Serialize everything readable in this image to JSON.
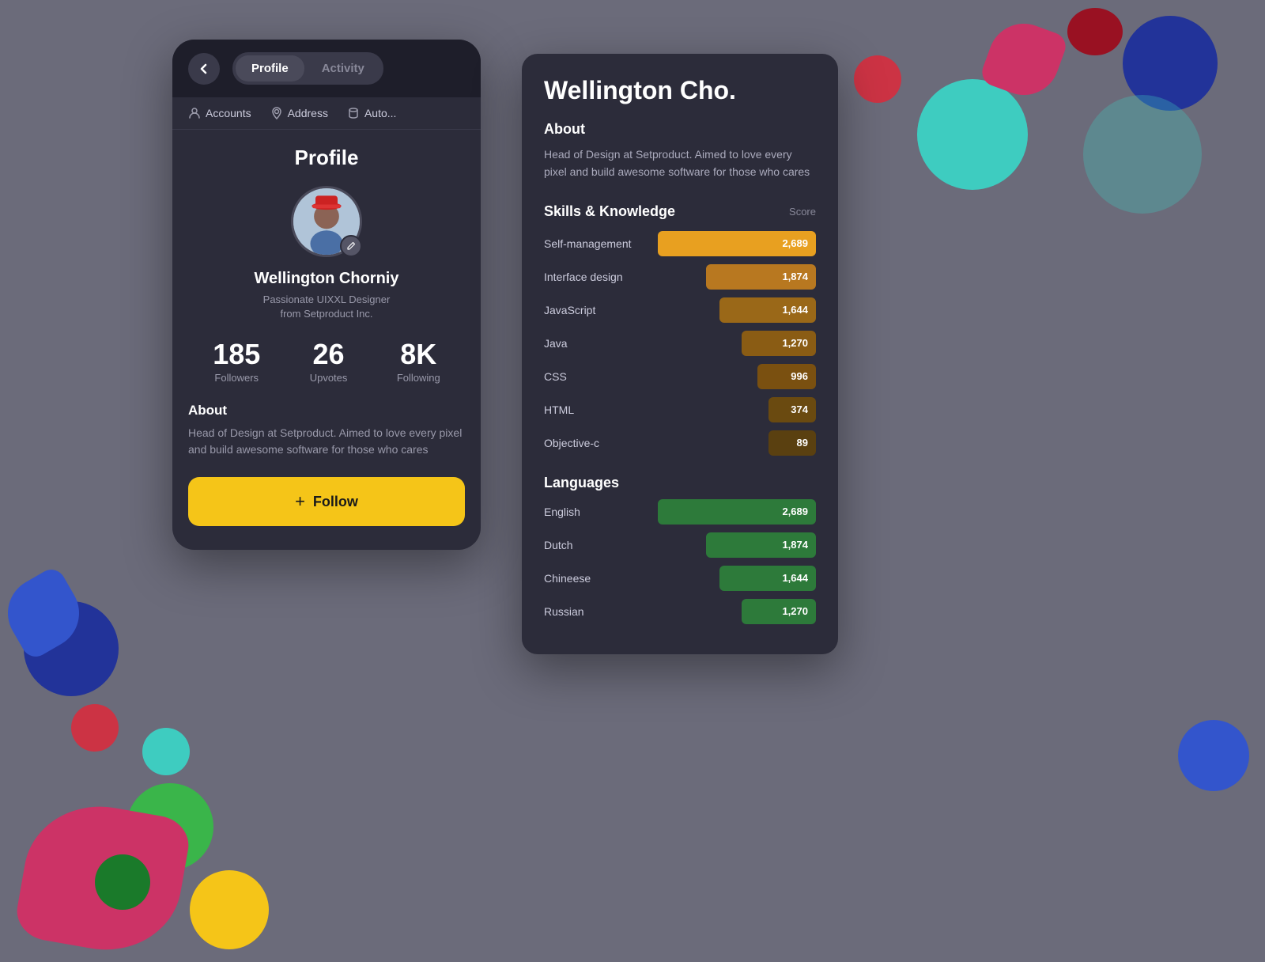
{
  "background_color": "#6b6b7a",
  "header": {
    "back_label": "<",
    "tabs": [
      {
        "label": "Profile",
        "active": true
      },
      {
        "label": "Activity",
        "active": false
      }
    ]
  },
  "sub_nav": {
    "items": [
      {
        "label": "Accounts",
        "icon": "user-icon"
      },
      {
        "label": "Address",
        "icon": "pin-icon"
      },
      {
        "label": "Auto...",
        "icon": "cylinder-icon"
      }
    ]
  },
  "profile": {
    "title": "Profile",
    "name": "Wellington Chorniy",
    "bio_line1": "Passionate UIXXL Designer",
    "bio_line2": "from Setproduct Inc.",
    "stats": [
      {
        "number": "185",
        "label": "Followers"
      },
      {
        "number": "26",
        "label": "Upvotes"
      },
      {
        "number": "8K",
        "label": "Following"
      }
    ],
    "about_title": "About",
    "about_text": "Head of Design at Setproduct. Aimed to love every pixel and build awesome software for those who cares",
    "follow_label": "Follow"
  },
  "detail": {
    "name": "Wellington Cho.",
    "about_title": "About",
    "about_text": "Head of Design at Setproduct. Aimed to love every pixel and build awesome software for those who cares",
    "skills_title": "Skills & Knowledge",
    "score_label": "Score",
    "skills": [
      {
        "name": "Self-management",
        "score": 2689,
        "max": 2689,
        "color": "#e8a020"
      },
      {
        "name": "Interface design",
        "score": 1874,
        "max": 2689,
        "color": "#b87820"
      },
      {
        "name": "JavaScript",
        "score": 1644,
        "max": 2689,
        "color": "#9a6818"
      },
      {
        "name": "Java",
        "score": 1270,
        "max": 2689,
        "color": "#8a5c14"
      },
      {
        "name": "CSS",
        "score": 996,
        "max": 2689,
        "color": "#7a5010"
      },
      {
        "name": "HTML",
        "score": 374,
        "max": 2689,
        "color": "#6a4a10"
      },
      {
        "name": "Objective-c",
        "score": 89,
        "max": 2689,
        "color": "#5a4010"
      }
    ],
    "languages_title": "Languages",
    "languages": [
      {
        "name": "English",
        "score": 2689,
        "max": 2689
      },
      {
        "name": "Dutch",
        "score": 1874,
        "max": 2689
      },
      {
        "name": "Chineese",
        "score": 1644,
        "max": 2689
      },
      {
        "name": "Russian",
        "score": 1270,
        "max": 2689
      }
    ]
  }
}
